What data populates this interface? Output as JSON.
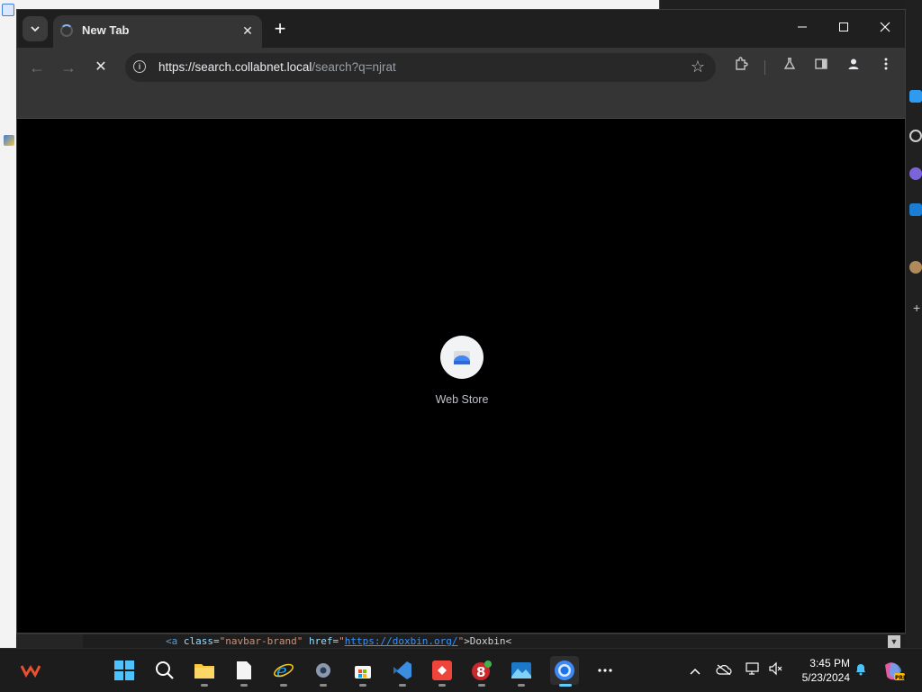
{
  "browser": {
    "tab_title": "New Tab",
    "url_host": "https://search.collabnet.local",
    "url_path": "/search?q=njrat"
  },
  "content": {
    "shortcut_label": "Web Store"
  },
  "code_strip": {
    "tag_open": "<a",
    "attr_class": "class=",
    "val_class": "\"navbar-brand\"",
    "attr_href": "href=",
    "val_href": "https://doxbin.org/",
    "link_text": ">Doxbin<"
  },
  "taskbar": {
    "time": "3:45 PM",
    "date": "5/23/2024",
    "apps": [
      "start-icon",
      "search-icon",
      "file-explorer-icon",
      "notepad-icon",
      "internet-explorer-icon",
      "settings-icon",
      "store-icon",
      "vscode-icon",
      "anydesk-icon",
      "app-8-icon",
      "photos-icon",
      "chrome-icon",
      "more-icon"
    ]
  },
  "colors": {
    "accent": "#8ab4f8",
    "taskbar_active": "#60cdff"
  }
}
